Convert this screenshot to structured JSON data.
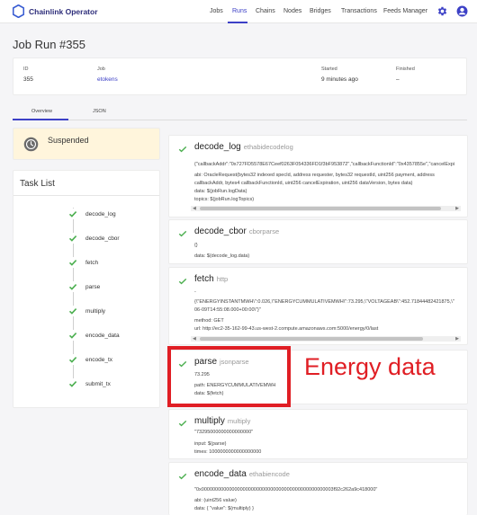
{
  "brand": {
    "name": "Chainlink Operator",
    "logo_icon": "chainlink-hexagon-icon"
  },
  "nav": {
    "items": [
      "Jobs",
      "Runs",
      "Chains",
      "Nodes",
      "Bridges",
      "Transactions",
      "Feeds Manager"
    ],
    "active": "Runs",
    "settings_icon": "gear-icon",
    "account_icon": "account-circle-icon"
  },
  "page": {
    "title": "Job Run #355"
  },
  "summary": {
    "id_label": "ID",
    "id_value": "355",
    "job_label": "Job",
    "job_value": "etokens",
    "started_label": "Started",
    "started_value": "9 minutes ago",
    "finished_label": "Finished",
    "finished_value": "–"
  },
  "tabs": [
    "Overview",
    "JSON"
  ],
  "status": {
    "text": "Suspended",
    "icon": "clock-icon"
  },
  "tasklist": {
    "title": "Task List",
    "items": [
      "decode_log",
      "decode_cbor",
      "fetch",
      "parse",
      "multiply",
      "encode_data",
      "encode_tx",
      "submit_tx"
    ]
  },
  "colors": {
    "accent": "#3c40c6",
    "success": "#4caf50",
    "suspended_bg": "#fff5dc",
    "annotation": "#e01e24"
  },
  "tasks": {
    "decode_log": {
      "name": "decode_log",
      "type": "ethabidecodelog",
      "output": "{\"callbackAddr\":\"0x727FD5578E67Ceef0263F054336FD1f3bF953872\",\"callbackFunctionId\":\"0x4357855e\",\"cancelExpi",
      "abi": "abi: OracleRequest(bytes32 indexed specId, address requester, bytes32 requestId, uint256 payment, address",
      "abi2": "callbackAddr, bytes4 callbackFunctionId, uint256 cancelExpiration, uint256 dataVersion, bytes data)",
      "data": "data: $(jobRun.logData)",
      "topics": "topics: $(jobRun.logTopics)"
    },
    "decode_cbor": {
      "name": "decode_cbor",
      "type": "cborparse",
      "output": "{}",
      "data": "data: $(decode_log.data)"
    },
    "fetch": {
      "name": "fetch",
      "type": "http",
      "dash": "-",
      "output": "{\\\"ENERGYINSTANTMWH\\\":0.026,\\\"ENERGYCUMMULATIVEMWH\\\":73.295,\\\"VOLTAGEAB\\\":452.71844482421875,\\\"",
      "output2": "06-09T14:55:08.000+00:00\\\"}\"",
      "method": "method: GET",
      "url": "url: http://ec2-35-162-99-43.us-west-2.compute.amazonaws.com:5000/energy/0/last"
    },
    "parse": {
      "name": "parse",
      "type": "jsonparse",
      "output": "73.295",
      "path": "path: ENERGYCUMMULATIVEMWH",
      "data": "data: $(fetch)"
    },
    "multiply": {
      "name": "multiply",
      "type": "multiply",
      "output": "\"73295000000000000000\"",
      "input": "input: $(parse)",
      "times": "times: 1000000000000000000"
    },
    "encode_data": {
      "name": "encode_data",
      "type": "ethabiencode",
      "output": "\"0x000000000000000000000000000000000000000000000003f92c262a9c418000\"",
      "abi": "abi: (uint256 value)",
      "data": "data: { \"value\": $(multiply) }"
    }
  },
  "annotation": {
    "text": "Energy data"
  }
}
